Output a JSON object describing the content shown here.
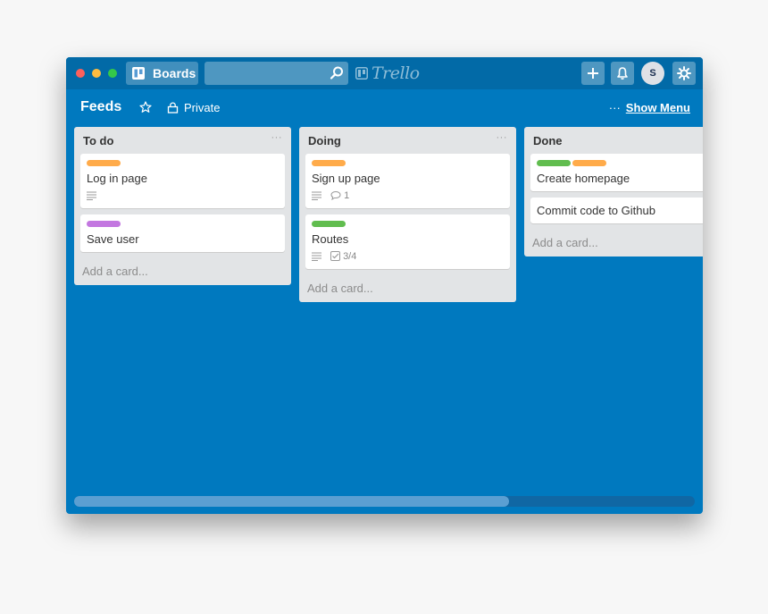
{
  "colors": {
    "board_bg": "#0079bf",
    "header_bg": "#026aa7",
    "light_red": "#fc605c",
    "light_yellow": "#fdbc40",
    "light_green": "#34c84a",
    "label_orange": "#ffab4a",
    "label_purple": "#c377e0",
    "label_green": "#61bd4f"
  },
  "topbar": {
    "boards_label": "Boards",
    "search_value": "",
    "logo_text": "Trello",
    "avatar_initial": "S"
  },
  "board": {
    "title": "Feeds",
    "visibility": "Private",
    "menu_dots": "···",
    "show_menu": "Show Menu"
  },
  "lists": [
    {
      "name": "To do",
      "more": "···",
      "add_card": "Add a card...",
      "cards": [
        {
          "title": "Log in page",
          "labels": [
            "orange"
          ],
          "has_description": true
        },
        {
          "title": "Save user",
          "labels": [
            "purple"
          ],
          "has_description": false
        }
      ]
    },
    {
      "name": "Doing",
      "more": "···",
      "add_card": "Add a card...",
      "cards": [
        {
          "title": "Sign up page",
          "labels": [
            "orange"
          ],
          "has_description": true,
          "comments": "1"
        },
        {
          "title": "Routes",
          "labels": [
            "green"
          ],
          "has_description": true,
          "checklist": "3/4"
        }
      ]
    },
    {
      "name": "Done",
      "more": "",
      "add_card": "Add a card...",
      "cards": [
        {
          "title": "Create homepage",
          "labels": [
            "green",
            "orange"
          ],
          "has_description": false
        },
        {
          "title": "Commit code to Github",
          "labels": [],
          "has_description": false
        }
      ]
    }
  ],
  "scrollbar": {
    "thumb_fraction": 0.7
  }
}
